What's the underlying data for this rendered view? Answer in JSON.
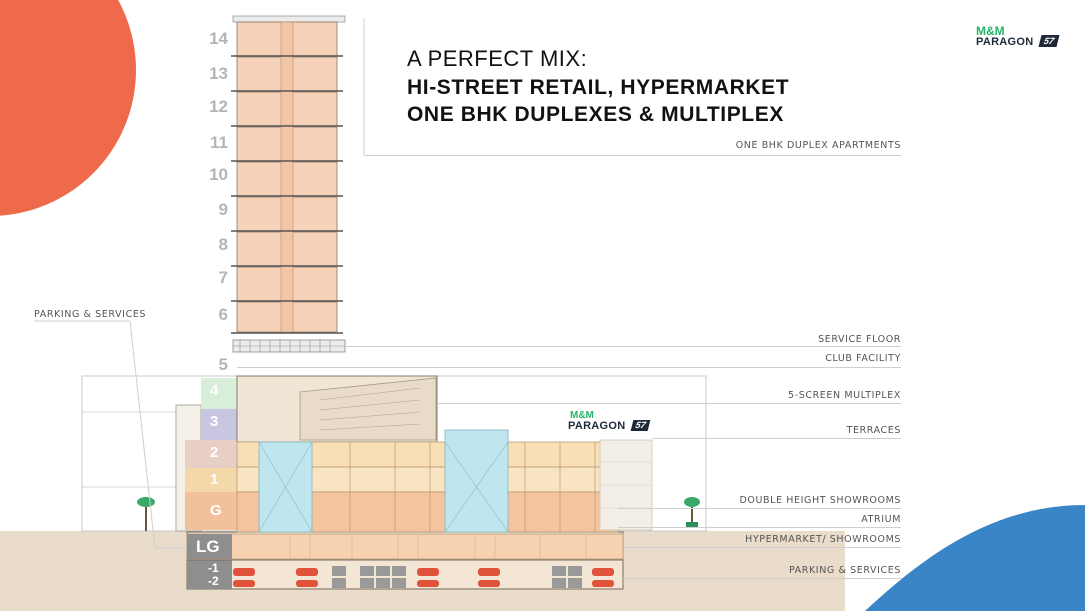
{
  "headline": {
    "line1": "A PERFECT MIX:",
    "line2": "HI-STREET RETAIL, HYPERMARKET",
    "line3": "ONE BHK DUPLEXES & MULTIPLEX"
  },
  "logo": {
    "brand": "M&M",
    "name": "PARAGON",
    "number": "57"
  },
  "labels": {
    "duplex": "ONE BHK DUPLEX APARTMENTS",
    "parking_services_left": "PARKING & SERVICES",
    "service_floor": "SERVICE FLOOR",
    "club_facility": "CLUB FACILITY",
    "multiplex": "5-SCREEN MULTIPLEX",
    "terraces": "TERRACES",
    "double_height": "DOUBLE HEIGHT SHOWROOMS",
    "atrium": "ATRIUM",
    "hypermarket": "HYPERMARKET/ SHOWROOMS",
    "parking_services": "PARKING & SERVICES"
  },
  "tower_floors": [
    "14",
    "13",
    "12",
    "11",
    "10",
    "9",
    "8",
    "7",
    "6",
    "5"
  ],
  "podium_floors": {
    "f4": "4",
    "f3": "3",
    "f2": "2",
    "f1": "1",
    "g": "G",
    "lg": "LG",
    "b1": "-1",
    "b2": "-2"
  },
  "colors": {
    "accent_orange": "#ee6a4a",
    "accent_blue": "#3a85c8",
    "apartment_fill": "#f6d2b8",
    "podium_peach": "#f9dfb6",
    "atrium_cyan": "#bfe6ee",
    "ground_beige": "#e9dccb",
    "logo_green": "#28b36a"
  }
}
